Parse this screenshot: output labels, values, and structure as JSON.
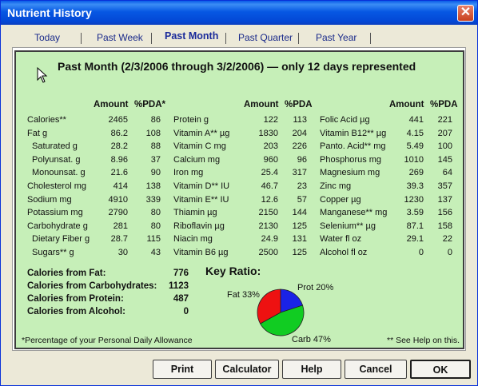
{
  "window": {
    "title": "Nutrient History",
    "close": "✕"
  },
  "tabs": [
    {
      "label": "Today",
      "active": false
    },
    {
      "label": "Past Week",
      "active": false
    },
    {
      "label": "Past Month",
      "active": true
    },
    {
      "label": "Past Quarter",
      "active": false
    },
    {
      "label": "Past Year",
      "active": false
    }
  ],
  "heading": "Past Month (2/3/2006 through 3/2/2006) — only 12 days represented",
  "column_headers": {
    "amount": "Amount",
    "pda_star": "%PDA*",
    "pda": "%PDA"
  },
  "col1": [
    {
      "label": "Calories**",
      "amount": "2465",
      "pda": "86"
    },
    {
      "label": "Fat  g",
      "amount": "86.2",
      "pda": "108"
    },
    {
      "label": "Saturated  g",
      "amount": "28.2",
      "pda": "88"
    },
    {
      "label": "Polyunsat.  g",
      "amount": "8.96",
      "pda": "37"
    },
    {
      "label": "Monounsat.  g",
      "amount": "21.6",
      "pda": "90"
    },
    {
      "label": "Cholesterol  mg",
      "amount": "414",
      "pda": "138"
    },
    {
      "label": "Sodium  mg",
      "amount": "4910",
      "pda": "339"
    },
    {
      "label": "Potassium  mg",
      "amount": "2790",
      "pda": "80"
    },
    {
      "label": "Carbohydrate  g",
      "amount": "281",
      "pda": "80"
    },
    {
      "label": "Dietary Fiber  g",
      "amount": "28.7",
      "pda": "115"
    },
    {
      "label": "Sugars**  g",
      "amount": "30",
      "pda": "43"
    }
  ],
  "col2": [
    {
      "label": "Protein  g",
      "amount": "122",
      "pda": "113"
    },
    {
      "label": "Vitamin A**  µg",
      "amount": "1830",
      "pda": "204"
    },
    {
      "label": "Vitamin C  mg",
      "amount": "203",
      "pda": "226"
    },
    {
      "label": "Calcium  mg",
      "amount": "960",
      "pda": "96"
    },
    {
      "label": "Iron  mg",
      "amount": "25.4",
      "pda": "317"
    },
    {
      "label": "Vitamin D**  IU",
      "amount": "46.7",
      "pda": "23"
    },
    {
      "label": "Vitamin E**  IU",
      "amount": "12.6",
      "pda": "57"
    },
    {
      "label": "Thiamin  µg",
      "amount": "2150",
      "pda": "144"
    },
    {
      "label": "Riboflavin  µg",
      "amount": "2130",
      "pda": "125"
    },
    {
      "label": "Niacin  mg",
      "amount": "24.9",
      "pda": "131"
    },
    {
      "label": "Vitamin B6  µg",
      "amount": "2500",
      "pda": "125"
    }
  ],
  "col3": [
    {
      "label": "Folic Acid  µg",
      "amount": "441",
      "pda": "221"
    },
    {
      "label": "Vitamin B12**  µg",
      "amount": "4.15",
      "pda": "207"
    },
    {
      "label": "Panto. Acid**  mg",
      "amount": "5.49",
      "pda": "100"
    },
    {
      "label": "Phosphorus  mg",
      "amount": "1010",
      "pda": "145"
    },
    {
      "label": "Magnesium  mg",
      "amount": "269",
      "pda": "64"
    },
    {
      "label": "Zinc  mg",
      "amount": "39.3",
      "pda": "357"
    },
    {
      "label": "Copper  µg",
      "amount": "1230",
      "pda": "137"
    },
    {
      "label": "Manganese**  mg",
      "amount": "3.59",
      "pda": "156"
    },
    {
      "label": "Selenium**  µg",
      "amount": "87.1",
      "pda": "158"
    },
    {
      "label": "Water  fl oz",
      "amount": "29.1",
      "pda": "22"
    },
    {
      "label": "Alcohol  fl oz",
      "amount": "0",
      "pda": "0"
    }
  ],
  "calories_from": [
    {
      "label": "Calories from Fat:",
      "value": "776"
    },
    {
      "label": "Calories from Carbohydrates:",
      "value": "1123"
    },
    {
      "label": "Calories from Protein:",
      "value": "487"
    },
    {
      "label": "Calories from Alcohol:",
      "value": "0"
    }
  ],
  "key_ratio": {
    "title": "Key Ratio:",
    "fat_label": "Fat 33%",
    "prot_label": "Prot 20%",
    "carb_label": "Carb 47%",
    "fat_pct": 33,
    "prot_pct": 20,
    "carb_pct": 47,
    "colors": {
      "fat": "#ee1111",
      "prot": "#1a22e6",
      "carb": "#11cc22"
    }
  },
  "footnotes": {
    "left": "*Percentage of your Personal Daily Allowance",
    "right": "** See Help on this."
  },
  "buttons": {
    "print": "Print",
    "calculator": "Calculator",
    "help": "Help",
    "cancel": "Cancel",
    "ok": "OK"
  }
}
